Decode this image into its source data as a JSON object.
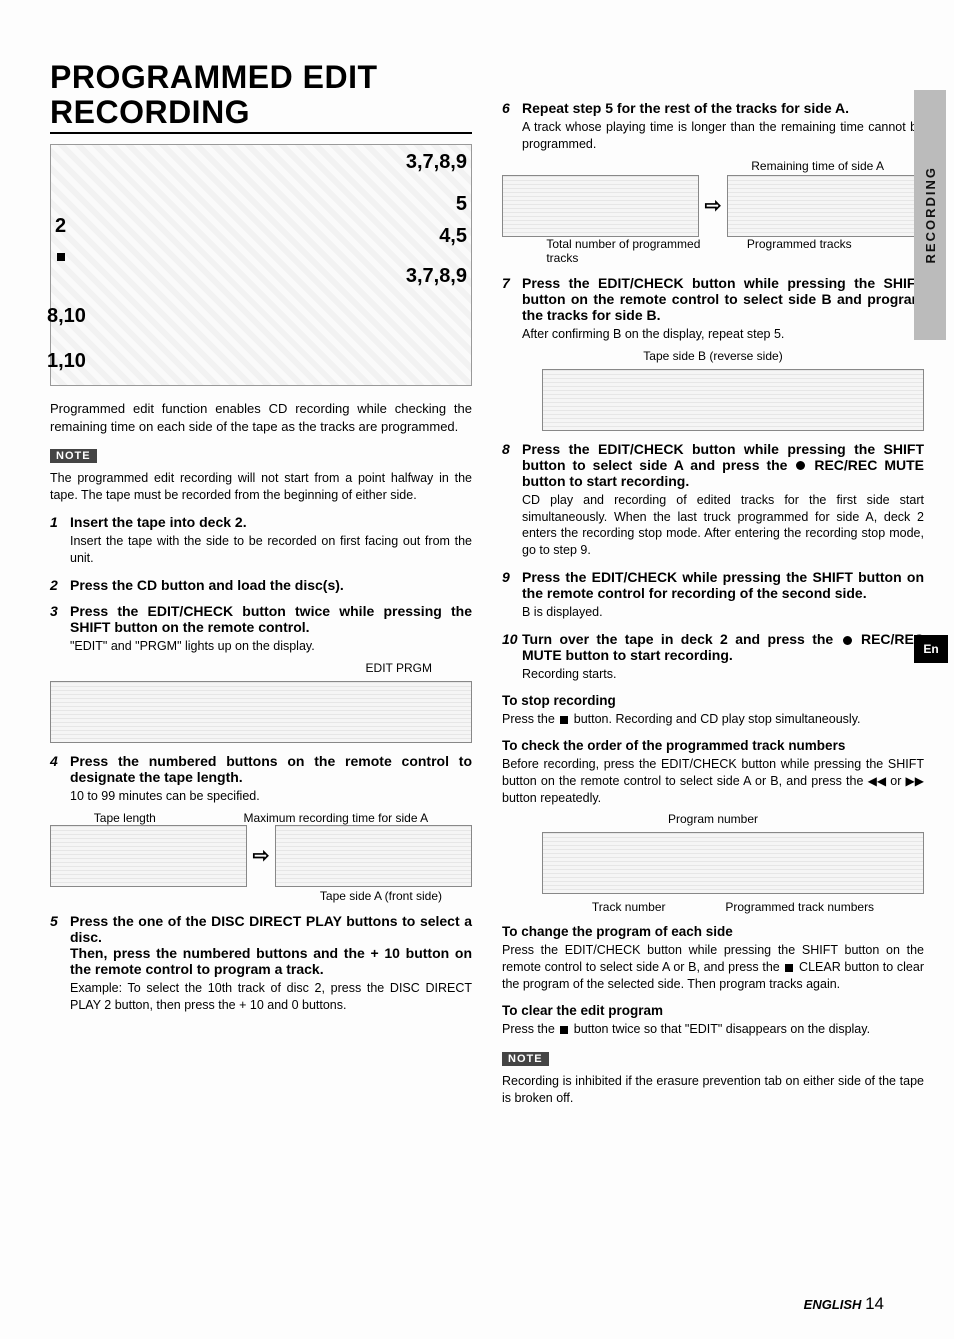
{
  "page": {
    "title": "PROGRAMMED EDIT RECORDING",
    "footer_label": "ENGLISH",
    "footer_page": "14",
    "side_tab": "RECORDING",
    "en_box": "En"
  },
  "fig": {
    "c1": "2",
    "c2": "8,10",
    "c3": "1,10",
    "c4": "3,7,8,9",
    "c5": "5",
    "c6": "4,5",
    "c7": "3,7,8,9",
    "stop_icon_name": "stop-icon"
  },
  "intro": "Programmed edit function enables CD recording while checking the remaining time on each side of the tape as the tracks are programmed.",
  "note1": "The programmed edit recording will not start from a point halfway in the tape. The tape must be recorded from the beginning of either side.",
  "note_label": "NOTE",
  "steps": {
    "s1": {
      "title": "Insert the tape into deck 2.",
      "sub": "Insert the tape with the side to be recorded on first facing out from the unit."
    },
    "s2": {
      "title": "Press the CD button and load the disc(s)."
    },
    "s3": {
      "title": "Press the EDIT/CHECK button twice while pressing the SHIFT button on the remote control.",
      "sub": "\"EDIT\" and \"PRGM\" lights up on the display.",
      "lcd_labels": "EDIT   PRGM"
    },
    "s4": {
      "title": "Press the numbered buttons on the remote control to designate the tape length.",
      "sub": "10 to 99 minutes can be specified.",
      "label_left": "Tape length",
      "label_right": "Maximum recording time for side A",
      "label_bottom": "Tape side A (front side)"
    },
    "s5": {
      "title": "Press the one of the DISC DIRECT PLAY buttons to select a disc.",
      "title2": "Then, press the numbered buttons and the + 10 button on the remote control to program a track.",
      "sub": "Example: To select the 10th track of disc 2, press the DISC DIRECT PLAY 2 button, then press the + 10 and 0 buttons."
    },
    "s6": {
      "title": "Repeat step 5 for the rest of the tracks for side A.",
      "sub": "A track whose playing time is longer than the remaining time cannot be programmed.",
      "label_top": "Remaining time of side A",
      "label_bl": "Total number of programmed tracks",
      "label_br": "Programmed tracks"
    },
    "s7": {
      "title": "Press the EDIT/CHECK button while pressing the SHIFT button on the remote control to select side B and program the tracks for side B.",
      "sub": "After confirming B on the display, repeat step 5.",
      "lcd_label": "Tape side B (reverse side)"
    },
    "s8": {
      "title_pre": "Press the EDIT/CHECK button while pressing the SHIFT button to select side A and press the ",
      "title_post": " REC/REC MUTE button to start recording.",
      "sub": "CD play and recording of edited tracks for the first side start simultaneously. When the last truck programmed for side A, deck 2 enters the recording stop mode. After entering the recording stop mode, go to step  9."
    },
    "s9": {
      "title": "Press the EDIT/CHECK while pressing the SHIFT button on the remote control for recording of the second side.",
      "sub": "B is displayed."
    },
    "s10": {
      "title_pre": "Turn over the tape in deck 2 and press the ",
      "title_post": " REC/REC MUTE button to start recording.",
      "sub": "Recording starts."
    }
  },
  "stoprec": {
    "head": "To stop recording",
    "pre": "Press the ",
    "post": " button. Recording and CD play stop simultaneously."
  },
  "checkorder": {
    "head": "To check the order of the programmed track numbers",
    "pre": "Before recording, press the EDIT/CHECK button while pressing the SHIFT button on the remote control to select side A or B, and press the ",
    "mid": " or ",
    "post": " button repeatedly.",
    "label_top": "Program number",
    "label_bl": "Track number",
    "label_br": "Programmed track numbers"
  },
  "changeprog": {
    "head": "To change the program of each side",
    "pre": "Press the EDIT/CHECK button while pressing the SHIFT button on the remote control to select side A or B, and press the ",
    "post": " CLEAR button to clear the program of the selected side. Then program tracks again."
  },
  "clearprog": {
    "head": "To clear the edit program",
    "pre": "Press the ",
    "post": " button twice so that \"EDIT\" disappears on the display."
  },
  "note2": "Recording is inhibited if the erasure prevention tab on either side of the tape is broken off."
}
